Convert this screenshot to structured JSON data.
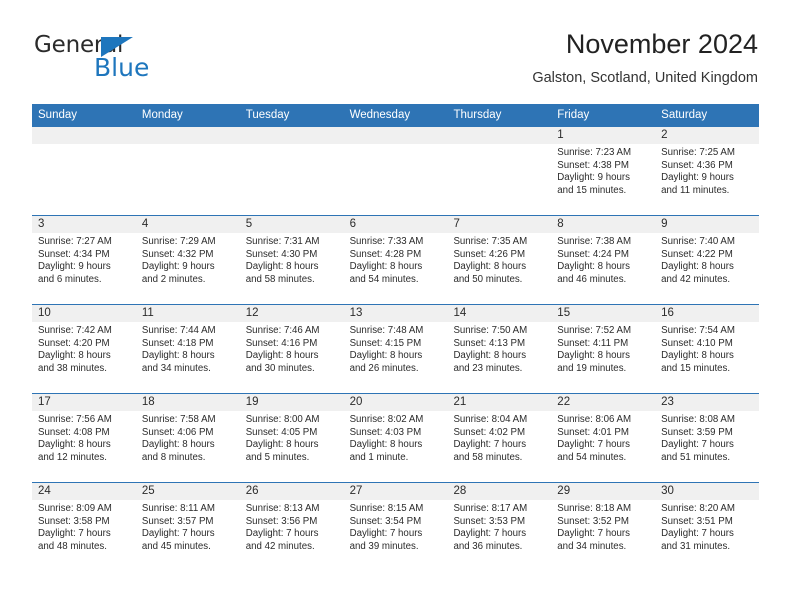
{
  "brand": {
    "name_part1": "General",
    "name_part2": "Blue",
    "triangle_color": "#1e76bd"
  },
  "header": {
    "title": "November 2024",
    "subtitle": "Galston, Scotland, United Kingdom"
  },
  "theme": {
    "header_blue": "#2e74b5",
    "day_band_gray": "#f0f0f0",
    "text": "#2b2b2b"
  },
  "weekdays": [
    "Sunday",
    "Monday",
    "Tuesday",
    "Wednesday",
    "Thursday",
    "Friday",
    "Saturday"
  ],
  "weeks": [
    [
      {
        "day": "",
        "sunrise": "",
        "sunset": "",
        "daylight_line1": "",
        "daylight_line2": ""
      },
      {
        "day": "",
        "sunrise": "",
        "sunset": "",
        "daylight_line1": "",
        "daylight_line2": ""
      },
      {
        "day": "",
        "sunrise": "",
        "sunset": "",
        "daylight_line1": "",
        "daylight_line2": ""
      },
      {
        "day": "",
        "sunrise": "",
        "sunset": "",
        "daylight_line1": "",
        "daylight_line2": ""
      },
      {
        "day": "",
        "sunrise": "",
        "sunset": "",
        "daylight_line1": "",
        "daylight_line2": ""
      },
      {
        "day": "1",
        "sunrise": "Sunrise: 7:23 AM",
        "sunset": "Sunset: 4:38 PM",
        "daylight_line1": "Daylight: 9 hours",
        "daylight_line2": "and 15 minutes."
      },
      {
        "day": "2",
        "sunrise": "Sunrise: 7:25 AM",
        "sunset": "Sunset: 4:36 PM",
        "daylight_line1": "Daylight: 9 hours",
        "daylight_line2": "and 11 minutes."
      }
    ],
    [
      {
        "day": "3",
        "sunrise": "Sunrise: 7:27 AM",
        "sunset": "Sunset: 4:34 PM",
        "daylight_line1": "Daylight: 9 hours",
        "daylight_line2": "and 6 minutes."
      },
      {
        "day": "4",
        "sunrise": "Sunrise: 7:29 AM",
        "sunset": "Sunset: 4:32 PM",
        "daylight_line1": "Daylight: 9 hours",
        "daylight_line2": "and 2 minutes."
      },
      {
        "day": "5",
        "sunrise": "Sunrise: 7:31 AM",
        "sunset": "Sunset: 4:30 PM",
        "daylight_line1": "Daylight: 8 hours",
        "daylight_line2": "and 58 minutes."
      },
      {
        "day": "6",
        "sunrise": "Sunrise: 7:33 AM",
        "sunset": "Sunset: 4:28 PM",
        "daylight_line1": "Daylight: 8 hours",
        "daylight_line2": "and 54 minutes."
      },
      {
        "day": "7",
        "sunrise": "Sunrise: 7:35 AM",
        "sunset": "Sunset: 4:26 PM",
        "daylight_line1": "Daylight: 8 hours",
        "daylight_line2": "and 50 minutes."
      },
      {
        "day": "8",
        "sunrise": "Sunrise: 7:38 AM",
        "sunset": "Sunset: 4:24 PM",
        "daylight_line1": "Daylight: 8 hours",
        "daylight_line2": "and 46 minutes."
      },
      {
        "day": "9",
        "sunrise": "Sunrise: 7:40 AM",
        "sunset": "Sunset: 4:22 PM",
        "daylight_line1": "Daylight: 8 hours",
        "daylight_line2": "and 42 minutes."
      }
    ],
    [
      {
        "day": "10",
        "sunrise": "Sunrise: 7:42 AM",
        "sunset": "Sunset: 4:20 PM",
        "daylight_line1": "Daylight: 8 hours",
        "daylight_line2": "and 38 minutes."
      },
      {
        "day": "11",
        "sunrise": "Sunrise: 7:44 AM",
        "sunset": "Sunset: 4:18 PM",
        "daylight_line1": "Daylight: 8 hours",
        "daylight_line2": "and 34 minutes."
      },
      {
        "day": "12",
        "sunrise": "Sunrise: 7:46 AM",
        "sunset": "Sunset: 4:16 PM",
        "daylight_line1": "Daylight: 8 hours",
        "daylight_line2": "and 30 minutes."
      },
      {
        "day": "13",
        "sunrise": "Sunrise: 7:48 AM",
        "sunset": "Sunset: 4:15 PM",
        "daylight_line1": "Daylight: 8 hours",
        "daylight_line2": "and 26 minutes."
      },
      {
        "day": "14",
        "sunrise": "Sunrise: 7:50 AM",
        "sunset": "Sunset: 4:13 PM",
        "daylight_line1": "Daylight: 8 hours",
        "daylight_line2": "and 23 minutes."
      },
      {
        "day": "15",
        "sunrise": "Sunrise: 7:52 AM",
        "sunset": "Sunset: 4:11 PM",
        "daylight_line1": "Daylight: 8 hours",
        "daylight_line2": "and 19 minutes."
      },
      {
        "day": "16",
        "sunrise": "Sunrise: 7:54 AM",
        "sunset": "Sunset: 4:10 PM",
        "daylight_line1": "Daylight: 8 hours",
        "daylight_line2": "and 15 minutes."
      }
    ],
    [
      {
        "day": "17",
        "sunrise": "Sunrise: 7:56 AM",
        "sunset": "Sunset: 4:08 PM",
        "daylight_line1": "Daylight: 8 hours",
        "daylight_line2": "and 12 minutes."
      },
      {
        "day": "18",
        "sunrise": "Sunrise: 7:58 AM",
        "sunset": "Sunset: 4:06 PM",
        "daylight_line1": "Daylight: 8 hours",
        "daylight_line2": "and 8 minutes."
      },
      {
        "day": "19",
        "sunrise": "Sunrise: 8:00 AM",
        "sunset": "Sunset: 4:05 PM",
        "daylight_line1": "Daylight: 8 hours",
        "daylight_line2": "and 5 minutes."
      },
      {
        "day": "20",
        "sunrise": "Sunrise: 8:02 AM",
        "sunset": "Sunset: 4:03 PM",
        "daylight_line1": "Daylight: 8 hours",
        "daylight_line2": "and 1 minute."
      },
      {
        "day": "21",
        "sunrise": "Sunrise: 8:04 AM",
        "sunset": "Sunset: 4:02 PM",
        "daylight_line1": "Daylight: 7 hours",
        "daylight_line2": "and 58 minutes."
      },
      {
        "day": "22",
        "sunrise": "Sunrise: 8:06 AM",
        "sunset": "Sunset: 4:01 PM",
        "daylight_line1": "Daylight: 7 hours",
        "daylight_line2": "and 54 minutes."
      },
      {
        "day": "23",
        "sunrise": "Sunrise: 8:08 AM",
        "sunset": "Sunset: 3:59 PM",
        "daylight_line1": "Daylight: 7 hours",
        "daylight_line2": "and 51 minutes."
      }
    ],
    [
      {
        "day": "24",
        "sunrise": "Sunrise: 8:09 AM",
        "sunset": "Sunset: 3:58 PM",
        "daylight_line1": "Daylight: 7 hours",
        "daylight_line2": "and 48 minutes."
      },
      {
        "day": "25",
        "sunrise": "Sunrise: 8:11 AM",
        "sunset": "Sunset: 3:57 PM",
        "daylight_line1": "Daylight: 7 hours",
        "daylight_line2": "and 45 minutes."
      },
      {
        "day": "26",
        "sunrise": "Sunrise: 8:13 AM",
        "sunset": "Sunset: 3:56 PM",
        "daylight_line1": "Daylight: 7 hours",
        "daylight_line2": "and 42 minutes."
      },
      {
        "day": "27",
        "sunrise": "Sunrise: 8:15 AM",
        "sunset": "Sunset: 3:54 PM",
        "daylight_line1": "Daylight: 7 hours",
        "daylight_line2": "and 39 minutes."
      },
      {
        "day": "28",
        "sunrise": "Sunrise: 8:17 AM",
        "sunset": "Sunset: 3:53 PM",
        "daylight_line1": "Daylight: 7 hours",
        "daylight_line2": "and 36 minutes."
      },
      {
        "day": "29",
        "sunrise": "Sunrise: 8:18 AM",
        "sunset": "Sunset: 3:52 PM",
        "daylight_line1": "Daylight: 7 hours",
        "daylight_line2": "and 34 minutes."
      },
      {
        "day": "30",
        "sunrise": "Sunrise: 8:20 AM",
        "sunset": "Sunset: 3:51 PM",
        "daylight_line1": "Daylight: 7 hours",
        "daylight_line2": "and 31 minutes."
      }
    ]
  ]
}
